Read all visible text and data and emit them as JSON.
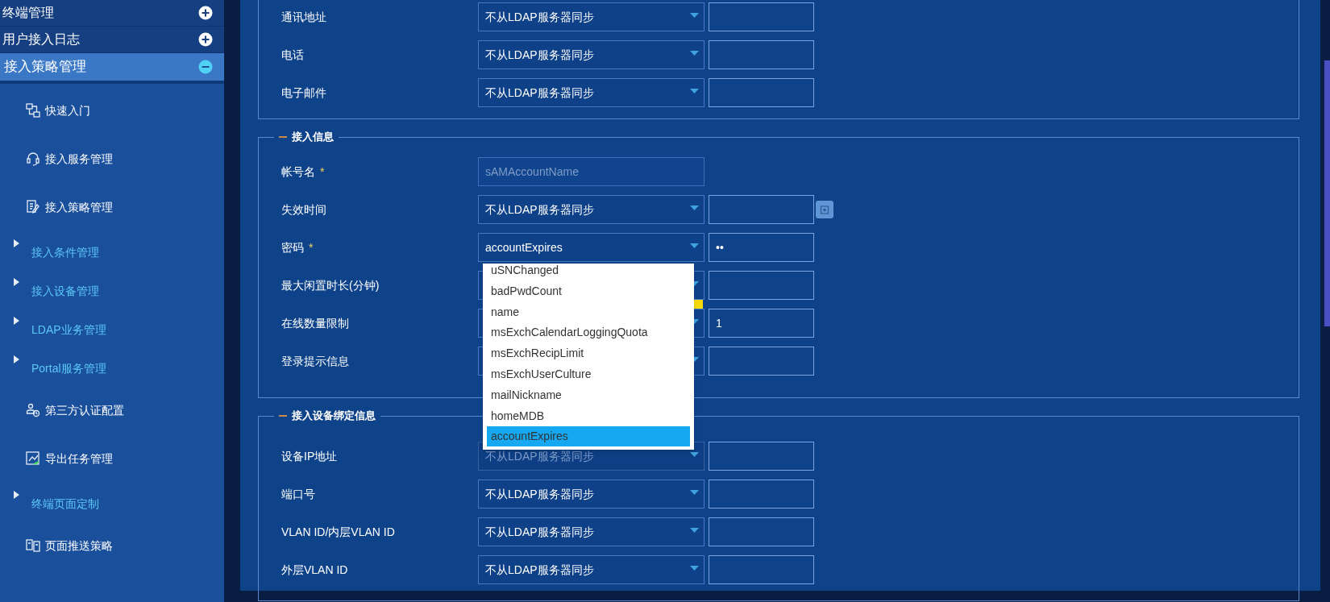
{
  "sidebar": {
    "items": [
      {
        "label": "终端管理",
        "expanded": false
      },
      {
        "label": "用户接入日志",
        "expanded": false
      },
      {
        "label": "接入策略管理",
        "expanded": true,
        "children": [
          {
            "kind": "page",
            "label": "快速入门"
          },
          {
            "kind": "page",
            "label": "接入服务管理"
          },
          {
            "kind": "page",
            "label": "接入策略管理"
          },
          {
            "kind": "group",
            "label": "接入条件管理"
          },
          {
            "kind": "group",
            "label": "接入设备管理"
          },
          {
            "kind": "group",
            "label": "LDAP业务管理"
          },
          {
            "kind": "group",
            "label": "Portal服务管理"
          },
          {
            "kind": "page",
            "label": "第三方认证配置"
          },
          {
            "kind": "page",
            "label": "导出任务管理"
          },
          {
            "kind": "group",
            "label": "终端页面定制"
          },
          {
            "kind": "page",
            "label": "页面推送策略"
          }
        ]
      }
    ]
  },
  "sections": [
    {
      "rows": [
        {
          "kind": "sync",
          "label": "通讯地址",
          "disabled": false,
          "select": "不从LDAP服务器同步"
        },
        {
          "kind": "sync",
          "label": "电话",
          "disabled": false,
          "select": "不从LDAP服务器同步"
        },
        {
          "kind": "sync",
          "label": "电子邮件",
          "disabled": false,
          "select": "不从LDAP服务器同步"
        }
      ]
    },
    {
      "title": "接入信息",
      "rows": [
        {
          "kind": "text",
          "label": "帐号名",
          "mark": "*",
          "disabled": true,
          "value": "sAMAccountName"
        },
        {
          "kind": "date",
          "label": "失效时间",
          "disabled": false,
          "select": "不从LDAP服务器同步"
        },
        {
          "kind": "sync",
          "label": "密码",
          "mark": "*",
          "disabled": false,
          "select": "accountExpires",
          "value": "••",
          "options": [
            {
              "label": "uSNChanged",
              "selected": false
            },
            {
              "label": "badPwdCount",
              "selected": false
            },
            {
              "label": "name",
              "selected": false
            },
            {
              "label": "msExchCalendarLoggingQuota",
              "selected": false
            },
            {
              "label": "msExchRecipLimit",
              "selected": false
            },
            {
              "label": "msExchUserCulture",
              "selected": false
            },
            {
              "label": "mailNickname",
              "selected": false
            },
            {
              "label": "homeMDB",
              "selected": false
            },
            {
              "label": "accountExpires",
              "selected": true
            }
          ]
        },
        {
          "kind": "sync",
          "label": "最大闲置时长(分钟)",
          "disabled": false
        },
        {
          "kind": "sync",
          "label": "在线数量限制",
          "disabled": false,
          "value": "1"
        },
        {
          "kind": "sync",
          "label": "登录提示信息",
          "disabled": false
        }
      ]
    },
    {
      "title": "接入设备绑定信息",
      "rows": [
        {
          "kind": "sync",
          "label": "设备IP地址",
          "disabled": true,
          "select": "不从LDAP服务器同步"
        },
        {
          "kind": "sync",
          "label": "端口号",
          "disabled": false,
          "select": "不从LDAP服务器同步"
        },
        {
          "kind": "sync",
          "label": "VLAN ID/内层VLAN ID",
          "disabled": false,
          "select": "不从LDAP服务器同步"
        },
        {
          "kind": "sync",
          "label": "外层VLAN ID",
          "disabled": false,
          "select": "不从LDAP服务器同步"
        }
      ]
    }
  ]
}
